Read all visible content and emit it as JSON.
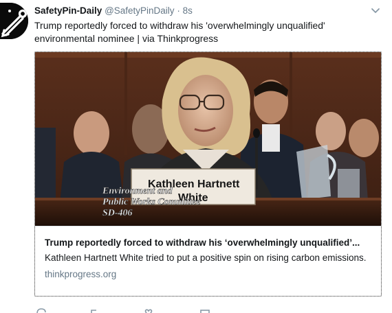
{
  "tweet": {
    "display_name": "SafetyPin-Daily",
    "handle": "@SafetyPinDaily",
    "separator": "·",
    "time": "8s",
    "text": "Trump reportedly forced to withdraw his 'overwhelmingly unqualified' environmental nominee  | via Thinkprogress"
  },
  "card": {
    "title": "Trump reportedly forced to withdraw his ‘overwhelmingly unqualified’...",
    "description": "Kathleen Hartnett White tried to put a positive spin on rising carbon emissions.",
    "domain": "thinkprogress.org",
    "image": {
      "nameplate_line1": "Kathleen Hartnett",
      "nameplate_line2": "White",
      "caption_line1": "Environment and",
      "caption_line2": "Public Works Committee",
      "caption_line3": "SD-406"
    }
  },
  "icons": {
    "avatar": "safety-pin-logo",
    "menu": "chevron-down-icon",
    "reply": "reply-icon",
    "retweet": "retweet-icon",
    "like": "heart-icon",
    "message": "envelope-icon"
  },
  "colors": {
    "text": "#14171a",
    "secondary": "#657786",
    "border": "#e1e8ed"
  }
}
